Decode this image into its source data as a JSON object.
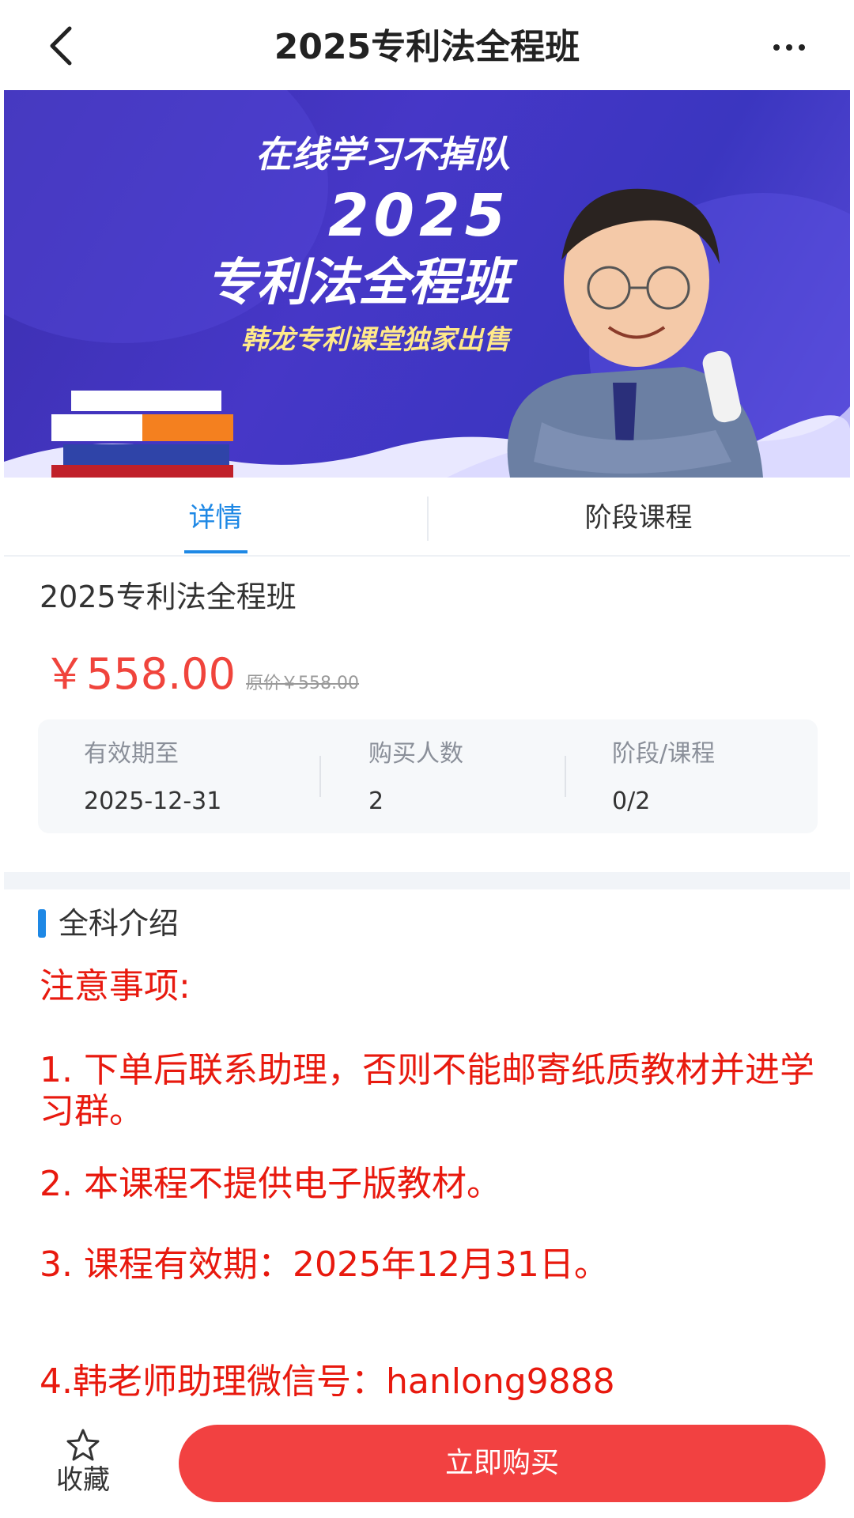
{
  "header": {
    "title": "2025专利法全程班",
    "back_icon": "chevron-left-icon",
    "more_label": "···"
  },
  "banner": {
    "line1": "在线学习不掉队",
    "line2": "2025",
    "line3": "专利法全程班",
    "line4": "韩龙专利课堂独家出售"
  },
  "tabs": {
    "detail": "详情",
    "stage_courses": "阶段课程"
  },
  "course": {
    "title": "2025专利法全程班",
    "price": "￥558.00",
    "original_price": "原价￥558.00"
  },
  "stats": {
    "valid_label": "有效期至",
    "valid_value": "2025-12-31",
    "buyers_label": "购买人数",
    "buyers_value": "2",
    "stage_label": "阶段/课程",
    "stage_value": "0/2"
  },
  "intro": {
    "title": "全科介绍",
    "notes_title": "注意事项:",
    "note1": "1. 下单后联系助理，否则不能邮寄纸质教材并进学习群。",
    "note2": "2. 本课程不提供电子版教材。",
    "note3": "3. 课程有效期：2025年12月31日。",
    "note4": "4.韩老师助理微信号：hanlong9888"
  },
  "bottom": {
    "favorite_label": "收藏",
    "buy_label": "立即购买"
  },
  "colors": {
    "accent_blue": "#1e88e5",
    "price_red": "#f0443c",
    "notice_red": "#e8190e",
    "buy_red": "#f24141"
  }
}
